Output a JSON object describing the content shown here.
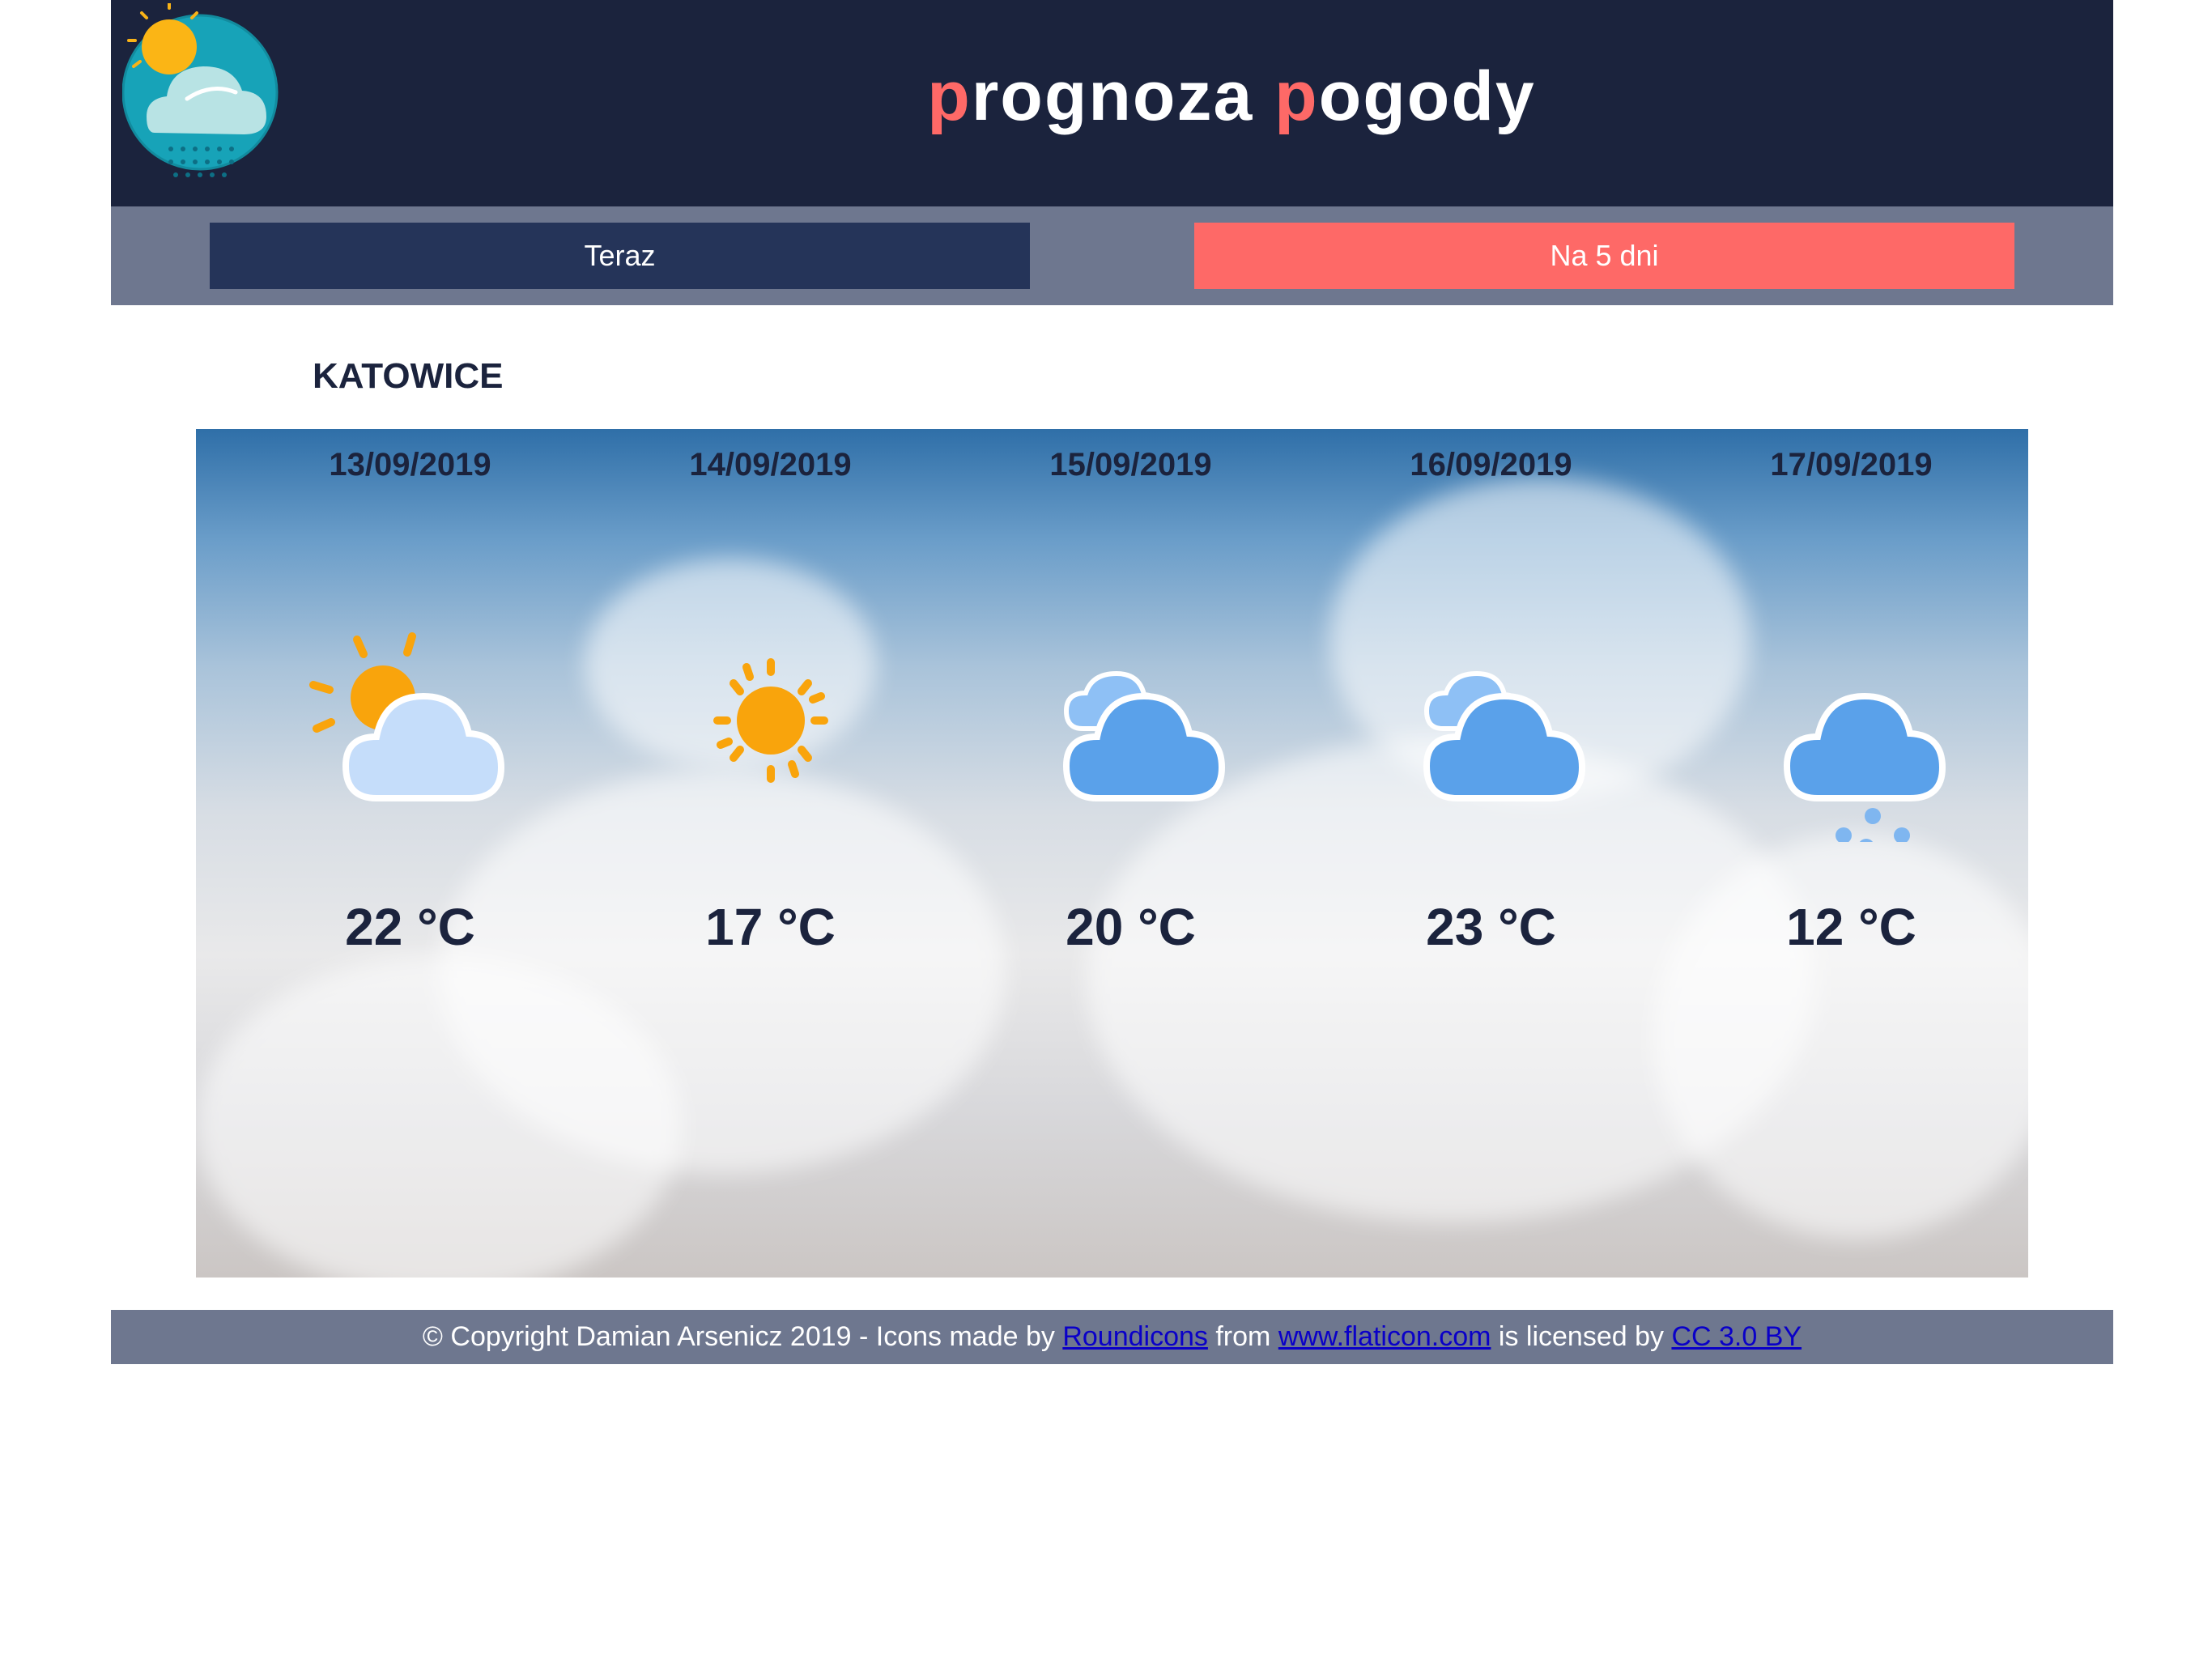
{
  "header": {
    "title_part1_accent": "p",
    "title_part1_rest": "rognoza ",
    "title_part2_accent": "p",
    "title_part2_rest": "ogody",
    "logo_icon": "weather-logo-icon"
  },
  "nav": {
    "now_label": "Teraz",
    "five_days_label": "Na 5 dni"
  },
  "city": "KATOWICE",
  "forecast": [
    {
      "date": "13/09/2019",
      "temp": "22 °C",
      "icon": "partly-sunny-icon"
    },
    {
      "date": "14/09/2019",
      "temp": "17 °C",
      "icon": "sunny-icon"
    },
    {
      "date": "15/09/2019",
      "temp": "20 °C",
      "icon": "cloudy-icon"
    },
    {
      "date": "16/09/2019",
      "temp": "23 °C",
      "icon": "cloudy-icon"
    },
    {
      "date": "17/09/2019",
      "temp": "12 °C",
      "icon": "snow-icon"
    }
  ],
  "footer": {
    "copyright": "© Copyright Damian Arsenicz 2019 - Icons made by ",
    "link1": "Roundicons",
    "text_from": " from ",
    "link2": "www.flaticon.com",
    "text_licensed": " is licensed by ",
    "link3": "CC 3.0 BY"
  },
  "colors": {
    "header_bg": "#1b233d",
    "accent": "#fe6967",
    "nav_bg": "#6e778f",
    "nav_active": "#253459"
  }
}
